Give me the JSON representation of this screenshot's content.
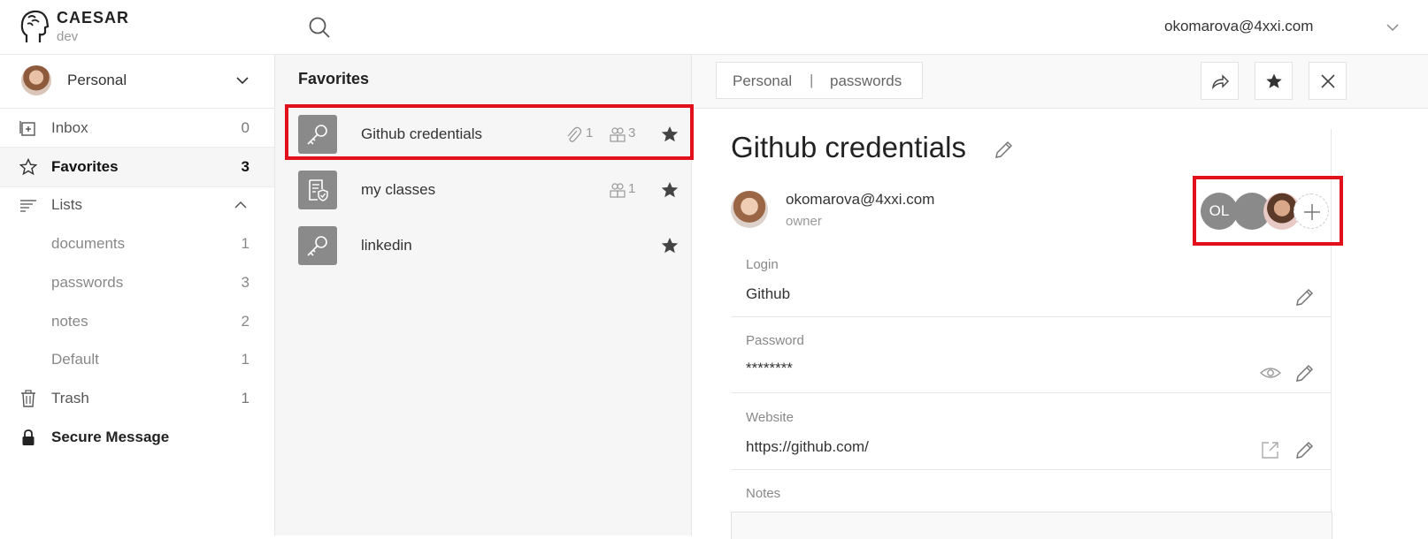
{
  "app": {
    "brand": "CAESAR",
    "env": "dev"
  },
  "header": {
    "user_email": "okomarova@4xxi.com"
  },
  "sidebar": {
    "team": "Personal",
    "items": [
      {
        "label": "Inbox",
        "count": "0"
      },
      {
        "label": "Favorites",
        "count": "3"
      },
      {
        "label": "Lists",
        "count": ""
      },
      {
        "label": "Trash",
        "count": "1"
      },
      {
        "label": "Secure Message",
        "count": ""
      }
    ],
    "lists": [
      {
        "label": "documents",
        "count": "1"
      },
      {
        "label": "passwords",
        "count": "3"
      },
      {
        "label": "notes",
        "count": "2"
      },
      {
        "label": "Default",
        "count": "1"
      }
    ]
  },
  "middle": {
    "title": "Favorites",
    "items": [
      {
        "name": "Github credentials",
        "attachments": "1",
        "members": "3"
      },
      {
        "name": "my classes",
        "members": "1"
      },
      {
        "name": "linkedin"
      }
    ]
  },
  "detail": {
    "breadcrumb": {
      "team": "Personal",
      "separator": "|",
      "list": "passwords"
    },
    "title": "Github credentials",
    "owner": {
      "email": "okomarova@4xxi.com",
      "role": "owner"
    },
    "shared_initials": "OL",
    "fields": [
      {
        "label": "Login",
        "value": "Github"
      },
      {
        "label": "Password",
        "value": "********"
      },
      {
        "label": "Website",
        "value": "https://github.com/"
      },
      {
        "label": "Notes",
        "value": ""
      }
    ]
  },
  "colors": {
    "highlight": "#e2101b",
    "icon_bg": "#8a8a8a",
    "active_bg": "#f6f6f6"
  }
}
